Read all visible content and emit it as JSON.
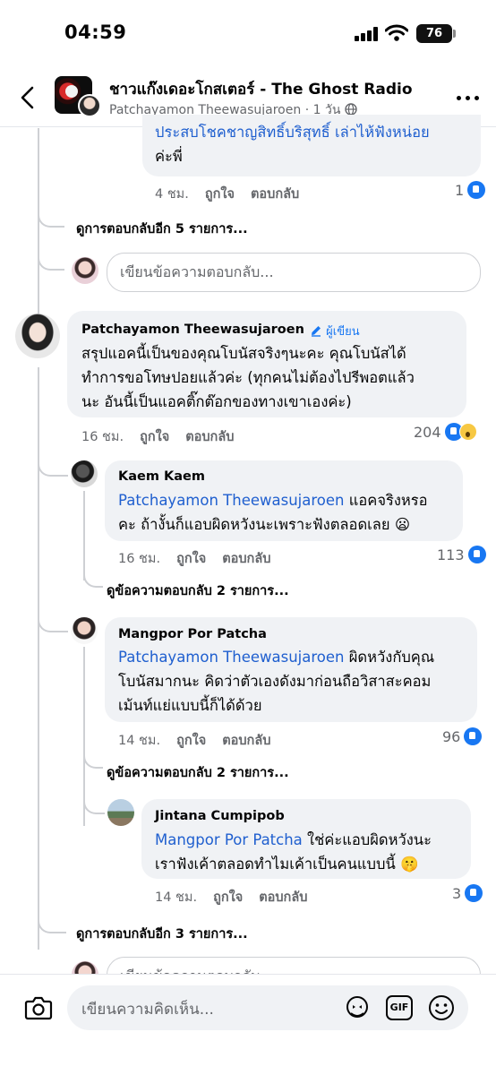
{
  "status": {
    "time": "04:59",
    "battery": "76"
  },
  "header": {
    "title": "ชาวแก๊งเดอะโกสเตอร์ - The Ghost Radio",
    "author": "Patchayamon Theewasujaroen",
    "dot": "·",
    "age": "1 วัน"
  },
  "prev_comment": {
    "text_line1": "ประสบโชคชาญสิทธิ์บริสุทธิ์ เล่าไห้ฟังหน่อย",
    "text_line2": "ค่ะพี่",
    "time": "4 ชม.",
    "like": "ถูกใจ",
    "reply": "ตอบกลับ",
    "count": "1"
  },
  "more_replies_1": "ดูการตอบกลับอีก 5 รายการ...",
  "reply_placeholder": "เขียนข้อความตอบกลับ...",
  "main_comment": {
    "name": "Patchayamon Theewasujaroen",
    "author_badge": "ผู้เขียน",
    "line1": "สรุปแอคนี้เป็นของคุณโบนัสจริงๆนะคะ คุณโบนัสได้",
    "line2": "ทำการขอโทษปอยแล้วค่ะ (ทุกคนไม่ต้องไปรีพอตแล้ว",
    "line3": "นะ อันนี้เป็นแอคติ๊กต๊อกของทางเขาเองค่ะ)",
    "time": "16 ชม.",
    "like": "ถูกใจ",
    "reply": "ตอบกลับ",
    "count": "204"
  },
  "reply1": {
    "name": "Kaem Kaem",
    "mention": "Patchayamon Theewasujaroen",
    "line1_rest": " แอคจริงหรอ",
    "line2": "คะ ถ้างั้นก็แอบผิดหวังนะเพราะฟังตลอดเลย 😦",
    "time": "16 ชม.",
    "like": "ถูกใจ",
    "reply": "ตอบกลับ",
    "count": "113",
    "more": "ดูข้อความตอบกลับ 2 รายการ..."
  },
  "reply2": {
    "name": "Mangpor Por Patcha",
    "mention": "Patchayamon Theewasujaroen",
    "line1_rest": " ผิดหวังกับคุณ",
    "line2": "โบนัสมากนะ คิดว่าตัวเองดังมาก่อนถือวิสาสะคอม",
    "line3": "เม้นท์แย่แบบนี้ก็ได้ด้วย",
    "time": "14 ชม.",
    "like": "ถูกใจ",
    "reply": "ตอบกลับ",
    "count": "96",
    "more": "ดูข้อความตอบกลับ 2 รายการ..."
  },
  "reply3": {
    "name": "Jintana Cumpipob",
    "mention": "Mangpor Por Patcha",
    "line1_rest": " ใช่ค่ะแอบผิดหวังนะ",
    "line2": "เราฟังเค้าตลอดทำไมเค้าเป็นคนแบบนี้ 🤫",
    "time": "14 ชม.",
    "like": "ถูกใจ",
    "reply": "ตอบกลับ",
    "count": "3"
  },
  "more_replies_2": "ดูการตอบกลับอีก 3 รายการ...",
  "bottom": {
    "placeholder": "เขียนความคิดเห็น...",
    "gif": "GIF"
  },
  "colors": {
    "accent": "#1877f2",
    "mention": "#1f5fcf",
    "bubble": "#f0f2f5"
  }
}
